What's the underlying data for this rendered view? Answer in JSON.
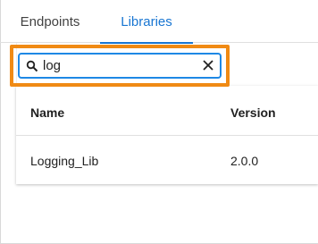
{
  "tabs": [
    {
      "label": "Endpoints",
      "active": false
    },
    {
      "label": "Libraries",
      "active": true
    }
  ],
  "search": {
    "value": "log",
    "icon": "search-icon",
    "clear_icon": "close-icon"
  },
  "table": {
    "columns": [
      "Name",
      "Version"
    ],
    "rows": [
      {
        "name": "Logging_Lib",
        "version": "2.0.0"
      }
    ]
  },
  "colors": {
    "accent": "#1976d2",
    "highlight": "#f08a14"
  }
}
